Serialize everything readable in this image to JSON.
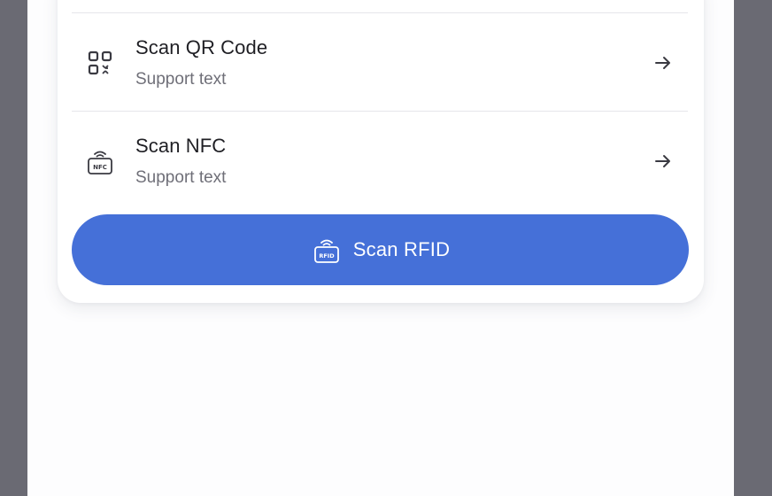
{
  "theme": {
    "accent": "#4570d8",
    "background_frame": "#6a6a73",
    "screen": "#fdfdfe"
  },
  "options": [
    {
      "title": "Scan QR Code",
      "support": "Support text",
      "icon": "qr-code-icon",
      "trailing_icon": "arrow-right-icon"
    },
    {
      "title": "Scan NFC",
      "support": "Support text",
      "icon": "nfc-icon",
      "trailing_icon": "arrow-right-icon"
    }
  ],
  "primary_action": {
    "label": "Scan RFID",
    "icon": "rfid-icon"
  }
}
